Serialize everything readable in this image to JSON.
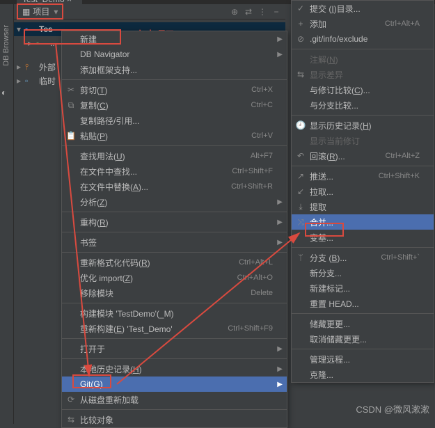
{
  "tab": {
    "title": "Test_Demo"
  },
  "panel": {
    "title": "项目"
  },
  "tree": {
    "root": "Tes",
    "ext": "外部",
    "scratch": "临时"
  },
  "left_rail": "DB Browser",
  "note": "右击项目",
  "watermark": "CSDN @微风漱漱",
  "menu1": [
    {
      "label": "新建",
      "sub": true
    },
    {
      "label": "DB Navigator",
      "sub": true
    },
    {
      "label": "添加框架支持..."
    },
    {
      "sep": true
    },
    {
      "label": "剪切(T)",
      "shortcut": "Ctrl+X",
      "icon": "cut"
    },
    {
      "label": "复制(C)",
      "shortcut": "Ctrl+C",
      "icon": "copy"
    },
    {
      "label": "复制路径/引用..."
    },
    {
      "label": "粘贴(P)",
      "shortcut": "Ctrl+V",
      "icon": "paste"
    },
    {
      "sep": true
    },
    {
      "label": "查找用法(U)",
      "shortcut": "Alt+F7"
    },
    {
      "label": "在文件中查找...",
      "shortcut": "Ctrl+Shift+F"
    },
    {
      "label": "在文件中替换(A)...",
      "shortcut": "Ctrl+Shift+R"
    },
    {
      "label": "分析(Z)",
      "sub": true
    },
    {
      "sep": true
    },
    {
      "label": "重构(R)",
      "sub": true
    },
    {
      "sep": true
    },
    {
      "label": "书签",
      "sub": true
    },
    {
      "sep": true
    },
    {
      "label": "重新格式化代码(R)",
      "shortcut": "Ctrl+Alt+L"
    },
    {
      "label": "优化 import(Z)",
      "shortcut": "Ctrl+Alt+O"
    },
    {
      "label": "移除模块",
      "shortcut": "Delete"
    },
    {
      "sep": true
    },
    {
      "label": "构建模块 'TestDemo'(_M)"
    },
    {
      "label": "重新构建(E) 'Test_Demo'",
      "shortcut": "Ctrl+Shift+F9"
    },
    {
      "sep": true
    },
    {
      "label": "打开于",
      "sub": true
    },
    {
      "sep": true
    },
    {
      "label": "本地历史记录(H)",
      "sub": true
    },
    {
      "label": "Git(G)",
      "sub": true,
      "highlighted": true
    },
    {
      "label": "从磁盘重新加载",
      "icon": "reload"
    },
    {
      "sep": true
    },
    {
      "label": "比较对象",
      "icon": "diff"
    }
  ],
  "menu2": [
    {
      "label": "提交 (I)目录...",
      "icon": "commit"
    },
    {
      "label": "添加",
      "shortcut": "Ctrl+Alt+A",
      "icon": "add"
    },
    {
      "label": ".git/info/exclude",
      "icon": "exclude"
    },
    {
      "sep": true
    },
    {
      "label": "注解(N)",
      "disabled": true
    },
    {
      "label": "显示差异",
      "disabled": true,
      "icon": "diff"
    },
    {
      "label": "与修订比较(C)..."
    },
    {
      "label": "与分支比较..."
    },
    {
      "sep": true
    },
    {
      "label": "显示历史记录(H)",
      "icon": "history"
    },
    {
      "label": "显示当前修订",
      "disabled": true
    },
    {
      "label": "回滚(R)...",
      "shortcut": "Ctrl+Alt+Z",
      "icon": "rollback"
    },
    {
      "sep": true
    },
    {
      "label": "推送...",
      "shortcut": "Ctrl+Shift+K",
      "icon": "push"
    },
    {
      "label": "拉取...",
      "icon": "pull"
    },
    {
      "label": "提取",
      "icon": "fetch"
    },
    {
      "label": "合并...",
      "icon": "merge",
      "highlighted": true
    },
    {
      "label": "变基..."
    },
    {
      "sep": true
    },
    {
      "label": "分支 (B)...",
      "shortcut": "Ctrl+Shift+`",
      "icon": "branch"
    },
    {
      "label": "新分支..."
    },
    {
      "label": "新建标记..."
    },
    {
      "label": "重置 HEAD..."
    },
    {
      "sep": true
    },
    {
      "label": "储藏更更..."
    },
    {
      "label": "取消储藏更更..."
    },
    {
      "sep": true
    },
    {
      "label": "管理远程..."
    },
    {
      "label": "克隆..."
    }
  ]
}
